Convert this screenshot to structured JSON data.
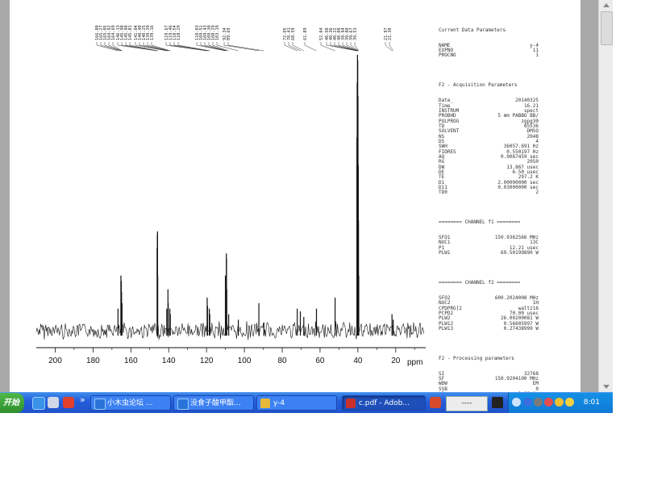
{
  "spectrum": {
    "axis_unit": "ppm",
    "ticks": [
      "200",
      "180",
      "160",
      "140",
      "120",
      "100",
      "80",
      "60",
      "40",
      "20"
    ],
    "peak_labels": [
      "166.80",
      "165.27",
      "165.05",
      "164.92",
      "164.69",
      "146.13",
      "145.98",
      "145.90",
      "145.81",
      "141.04",
      "140.40",
      "140.25",
      "139.39",
      "139.16",
      "119.67",
      "119.46",
      "118.54",
      "118.29",
      "110.03",
      "109.51",
      "109.43",
      "109.30",
      "108.29",
      "103.19",
      "92.34",
      "89.69",
      "72.05",
      "70.41",
      "68.59",
      "61.89",
      "52.04",
      "40.50",
      "40.36",
      "40.22",
      "40.08",
      "39.94",
      "39.80",
      "39.67",
      "39.53",
      "21.97",
      "21.30"
    ]
  },
  "chart_data": {
    "type": "line",
    "title": "",
    "xlabel": "ppm",
    "ylabel": "",
    "xlim": [
      210,
      5
    ],
    "x_reversed": true,
    "peaks": [
      {
        "x": 166.8,
        "y": 0.08
      },
      {
        "x": 165.27,
        "y": 0.2
      },
      {
        "x": 165.05,
        "y": 0.18
      },
      {
        "x": 164.92,
        "y": 0.14
      },
      {
        "x": 164.69,
        "y": 0.1
      },
      {
        "x": 146.13,
        "y": 0.3
      },
      {
        "x": 145.98,
        "y": 0.35
      },
      {
        "x": 145.9,
        "y": 0.36
      },
      {
        "x": 145.81,
        "y": 0.2
      },
      {
        "x": 141.04,
        "y": 0.08
      },
      {
        "x": 140.4,
        "y": 0.15
      },
      {
        "x": 140.25,
        "y": 0.1
      },
      {
        "x": 139.39,
        "y": 0.08
      },
      {
        "x": 139.16,
        "y": 0.06
      },
      {
        "x": 119.67,
        "y": 0.12
      },
      {
        "x": 119.46,
        "y": 0.09
      },
      {
        "x": 118.54,
        "y": 0.08
      },
      {
        "x": 118.29,
        "y": 0.06
      },
      {
        "x": 110.03,
        "y": 0.2
      },
      {
        "x": 109.51,
        "y": 0.28
      },
      {
        "x": 109.43,
        "y": 0.26
      },
      {
        "x": 109.3,
        "y": 0.15
      },
      {
        "x": 108.29,
        "y": 0.06
      },
      {
        "x": 103.19,
        "y": 0.04
      },
      {
        "x": 92.34,
        "y": 0.1
      },
      {
        "x": 89.69,
        "y": 0.03
      },
      {
        "x": 72.05,
        "y": 0.08
      },
      {
        "x": 70.41,
        "y": 0.07
      },
      {
        "x": 68.59,
        "y": 0.05
      },
      {
        "x": 61.89,
        "y": 0.08
      },
      {
        "x": 52.04,
        "y": 0.12
      },
      {
        "x": 40.5,
        "y": 0.7
      },
      {
        "x": 40.36,
        "y": 0.9
      },
      {
        "x": 40.22,
        "y": 1.0
      },
      {
        "x": 40.08,
        "y": 0.98
      },
      {
        "x": 39.94,
        "y": 0.85
      },
      {
        "x": 39.8,
        "y": 0.6
      },
      {
        "x": 39.67,
        "y": 0.4
      },
      {
        "x": 39.53,
        "y": 0.2
      },
      {
        "x": 21.97,
        "y": 0.06
      },
      {
        "x": 21.3,
        "y": 0.04
      }
    ]
  },
  "params": {
    "heading1": "Current Data Parameters",
    "current": [
      [
        "NAME",
        "y-4"
      ],
      [
        "EXPNO",
        "11"
      ],
      [
        "PROCNO",
        "1"
      ]
    ],
    "heading2": "F2 - Acquisition Parameters",
    "acq": [
      [
        "Date_",
        "20140325"
      ],
      [
        "Time",
        "16.21"
      ],
      [
        "INSTRUM",
        "spect"
      ],
      [
        "PROBHD",
        "5 mm PABBO BB/"
      ],
      [
        "PULPROG",
        "zgpg30"
      ],
      [
        "TD",
        "65536"
      ],
      [
        "SOLVENT",
        "DMSO"
      ],
      [
        "NS",
        "2048"
      ],
      [
        "DS",
        "4"
      ],
      [
        "SWH",
        "36057.691 Hz"
      ],
      [
        "FIDRES",
        "0.550197 Hz"
      ],
      [
        "AQ",
        "0.9087459 sec"
      ],
      [
        "RG",
        "2050"
      ],
      [
        "DW",
        "13.867 usec"
      ],
      [
        "DE",
        "6.50 usec"
      ],
      [
        "TE",
        "297.2 K"
      ],
      [
        "D1",
        "2.00000000 sec"
      ],
      [
        "D11",
        "0.03000000 sec"
      ],
      [
        "TD0",
        "2"
      ]
    ],
    "heading3": "======== CHANNEL f1 ========",
    "ch1": [
      [
        "SFO1",
        "150.9362566 MHz"
      ],
      [
        "NUC1",
        "13C"
      ],
      [
        "P1",
        "12.21 usec"
      ],
      [
        "PLW1",
        "69.50199890 W"
      ]
    ],
    "heading4": "======== CHANNEL f2 ========",
    "ch2": [
      [
        "SFO2",
        "600.2024008 MHz"
      ],
      [
        "NUC2",
        "1H"
      ],
      [
        "CPDPRG[2",
        "waltz16"
      ],
      [
        "PCPD2",
        "70.00 usec"
      ],
      [
        "PLW2",
        "26.00200081 W"
      ],
      [
        "PLW12",
        "0.56605997 W"
      ],
      [
        "PLW13",
        "0.27438999 W"
      ]
    ],
    "heading5": "F2 - Processing parameters",
    "proc": [
      [
        "SI",
        "32768"
      ],
      [
        "SF",
        "150.9204100 MHz"
      ],
      [
        "WDW",
        "EM"
      ],
      [
        "SSB",
        "0"
      ],
      [
        "LB",
        "1.00 Hz"
      ],
      [
        "GB",
        "0"
      ],
      [
        "PC",
        "1.40"
      ]
    ]
  },
  "taskbar": {
    "start_label": "开始",
    "buttons": [
      {
        "label": "小木虫论坛 ...",
        "color": "#2a74d9"
      },
      {
        "label": "没食子酸甲酯...",
        "color": "#2a74d9"
      },
      {
        "label": "y-4",
        "color": "#e8b83a"
      },
      {
        "label": "c.pdf - Adob...",
        "color": "#c8302a"
      }
    ],
    "ime_text": "----",
    "clock": "8:01"
  }
}
